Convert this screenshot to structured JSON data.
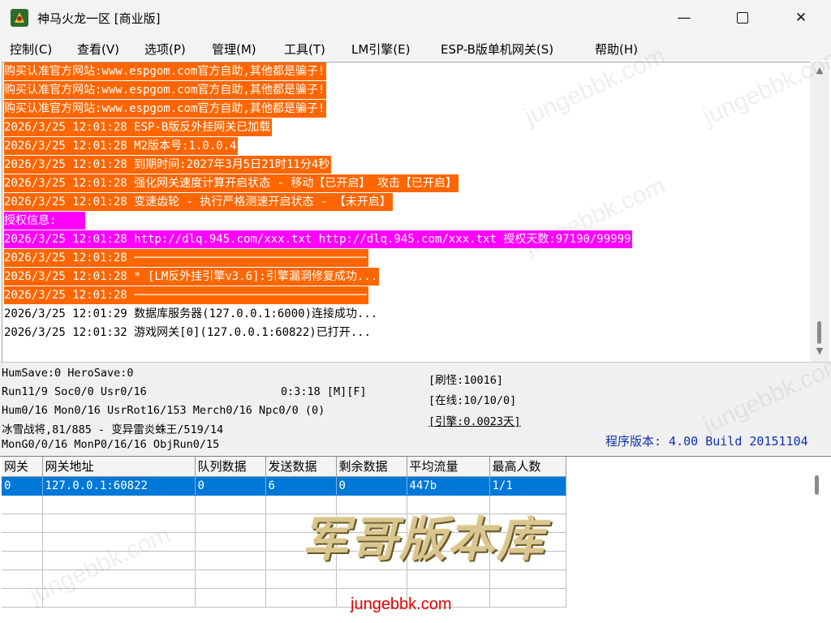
{
  "window": {
    "title": "神马火龙一区 [商业版]",
    "minimize_label": "—",
    "close_label": "✕"
  },
  "menu": [
    {
      "label": "控制(C)"
    },
    {
      "label": "查看(V)"
    },
    {
      "label": "选项(P)"
    },
    {
      "label": "管理(M)"
    },
    {
      "label": "工具(T)"
    },
    {
      "label": "LM引擎(E)"
    },
    {
      "label": "ESP-B版单机网关(S)"
    },
    {
      "label": "帮助(H)"
    }
  ],
  "log": [
    {
      "text": "购买认准官方网站:www.espgom.com官方自助,其他都是骗子!",
      "highlight": "orange"
    },
    {
      "text": "购买认准官方网站:www.espgom.com官方自助,其他都是骗子!",
      "highlight": "orange"
    },
    {
      "text": "购买认准官方网站:www.espgom.com官方自助,其他都是骗子!",
      "highlight": "orange"
    },
    {
      "text": "2026/3/25 12:01:28 ESP-B版反外挂网关已加载",
      "highlight": "orange"
    },
    {
      "text": "2026/3/25 12:01:28 M2版本号:1.0.0.4",
      "highlight": "orange"
    },
    {
      "text": "2026/3/25 12:01:28 到期时间:2027年3月5日21时11分4秒",
      "highlight": "orange"
    },
    {
      "text": "2026/3/25 12:01:28 强化网关速度计算开启状态 - 移动【已开启】 攻击【已开启】",
      "highlight": "orange"
    },
    {
      "text": "2026/3/25 12:01:28 变速齿轮 - 执行严格测速开启状态 - 【未开启】",
      "highlight": "orange"
    },
    {
      "text": "授权信息:    ",
      "highlight": "magenta"
    },
    {
      "text": "2026/3/25 12:01:28 http://dlq.945.com/xxx.txt http://dlq.945.com/xxx.txt 授权天数:97190/99999",
      "highlight": "magenta"
    },
    {
      "text": "2026/3/25 12:01:28 ──────────────────────────────────",
      "highlight": "orange"
    },
    {
      "text": "2026/3/25 12:01:28 * [LM反外挂引擎v3.6]:引擎漏洞修复成功...",
      "highlight": "orange"
    },
    {
      "text": "2026/3/25 12:01:28 ──────────────────────────────────",
      "highlight": "orange"
    },
    {
      "text": "2026/3/25 12:01:29 数据库服务器(127.0.0.1:6000)连接成功...",
      "highlight": "none"
    },
    {
      "text": "2026/3/25 12:01:32 游戏网关[0](127.0.0.1:60822)已打开...",
      "highlight": "none"
    }
  ],
  "log_scroll": {
    "up": "▲",
    "down": "▼"
  },
  "status": {
    "save": "HumSave:0 HeroSave:0",
    "run": "Run11/9 Soc0/0 Usr0/16",
    "runtime": "0:3:18 [M][F]",
    "counts": "Hum0/16 Mon0/16 UsrRot16/153 Merch0/16 Npc0/0 (0)",
    "monster": "冰雪战将,81/885 - 变异雷炎蛛王/519/14",
    "mong": "MonG0/0/16 MonP0/16/16 ObjRun0/15",
    "refresh": "[刷怪:10016]",
    "online": "[在线:10/10/0]",
    "engine": "[引擎:0.0023天]",
    "version": "程序版本: 4.00 Build 20151104"
  },
  "table": {
    "headers": [
      "网关",
      "网关地址",
      "队列数据",
      "发送数据",
      "剩余数据",
      "平均流量",
      "最高人数"
    ],
    "rows": [
      [
        "0",
        "127.0.0.1:60822",
        "0",
        "6",
        "0",
        "447b",
        "1/1"
      ]
    ],
    "empty_rows": 6
  },
  "watermark": {
    "brand": "军哥版本库",
    "url": "jungebbk.com",
    "faint": "jungebbk.com"
  },
  "colors": {
    "log_orange": "#ff6600",
    "log_magenta": "#ff00ff",
    "selection": "#0078d7",
    "version_text": "#1030b0"
  }
}
